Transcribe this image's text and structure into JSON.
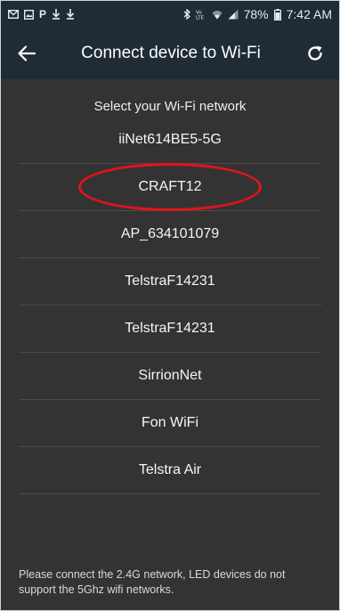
{
  "status_bar": {
    "battery": "78%",
    "time": "7:42 AM",
    "left_icons": [
      "mail-icon",
      "image-icon",
      "p-app-icon",
      "download-icon",
      "download-icon"
    ],
    "right_icons": [
      "bluetooth-icon",
      "volte-icon",
      "wifi-icon",
      "signal-icon",
      "battery-icon"
    ]
  },
  "app_bar": {
    "title": "Connect device to Wi-Fi",
    "back_icon": "arrow-left-icon",
    "refresh_icon": "refresh-icon"
  },
  "main": {
    "subtitle": "Select your Wi-Fi network",
    "networks": [
      {
        "name": "iiNet614BE5-5G"
      },
      {
        "name": "CRAFT12",
        "highlighted": true
      },
      {
        "name": "AP_634101079"
      },
      {
        "name": "TelstraF14231"
      },
      {
        "name": "TelstraF14231"
      },
      {
        "name": "SirrionNet"
      },
      {
        "name": "Fon WiFi"
      },
      {
        "name": "Telstra Air"
      }
    ],
    "footer_note": "Please connect the 2.4G network, LED devices do not support the 5Ghz wifi networks."
  },
  "colors": {
    "app_bar_bg": "#1f2b35",
    "content_bg": "#333333",
    "highlight": "#e0141b"
  }
}
